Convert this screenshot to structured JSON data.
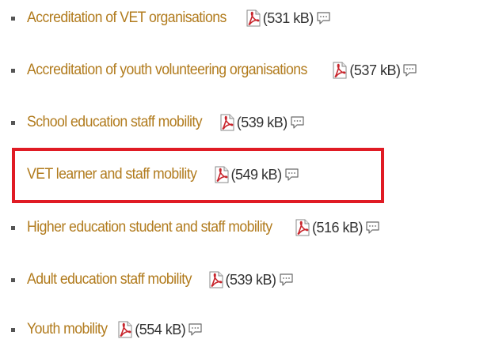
{
  "colors": {
    "link": "#b17b1d",
    "highlight": "#e01b24",
    "pdf_red": "#c8252c"
  },
  "items": [
    {
      "label": "Accreditation of VET organisations",
      "size": "(531 kB)",
      "icon": "pdf-icon",
      "comment_icon": "comment-icon"
    },
    {
      "label": "Accreditation of youth volunteering organisations",
      "size": "(537 kB)",
      "icon": "pdf-icon",
      "comment_icon": "comment-icon"
    },
    {
      "label": "School education staff mobility",
      "size": "(539 kB)",
      "icon": "pdf-icon",
      "comment_icon": "comment-icon"
    },
    {
      "label": "VET learner and staff mobility",
      "size": "(549 kB)",
      "icon": "pdf-icon",
      "comment_icon": "comment-icon",
      "highlighted": true
    },
    {
      "label": "Higher education student and staff mobility",
      "size": "(516 kB)",
      "icon": "pdf-icon",
      "comment_icon": "comment-icon"
    },
    {
      "label": "Adult education staff mobility",
      "size": "(539 kB)",
      "icon": "pdf-icon",
      "comment_icon": "comment-icon"
    },
    {
      "label": "Youth mobility",
      "size": "(554 kB)",
      "icon": "pdf-icon",
      "comment_icon": "comment-icon"
    }
  ]
}
